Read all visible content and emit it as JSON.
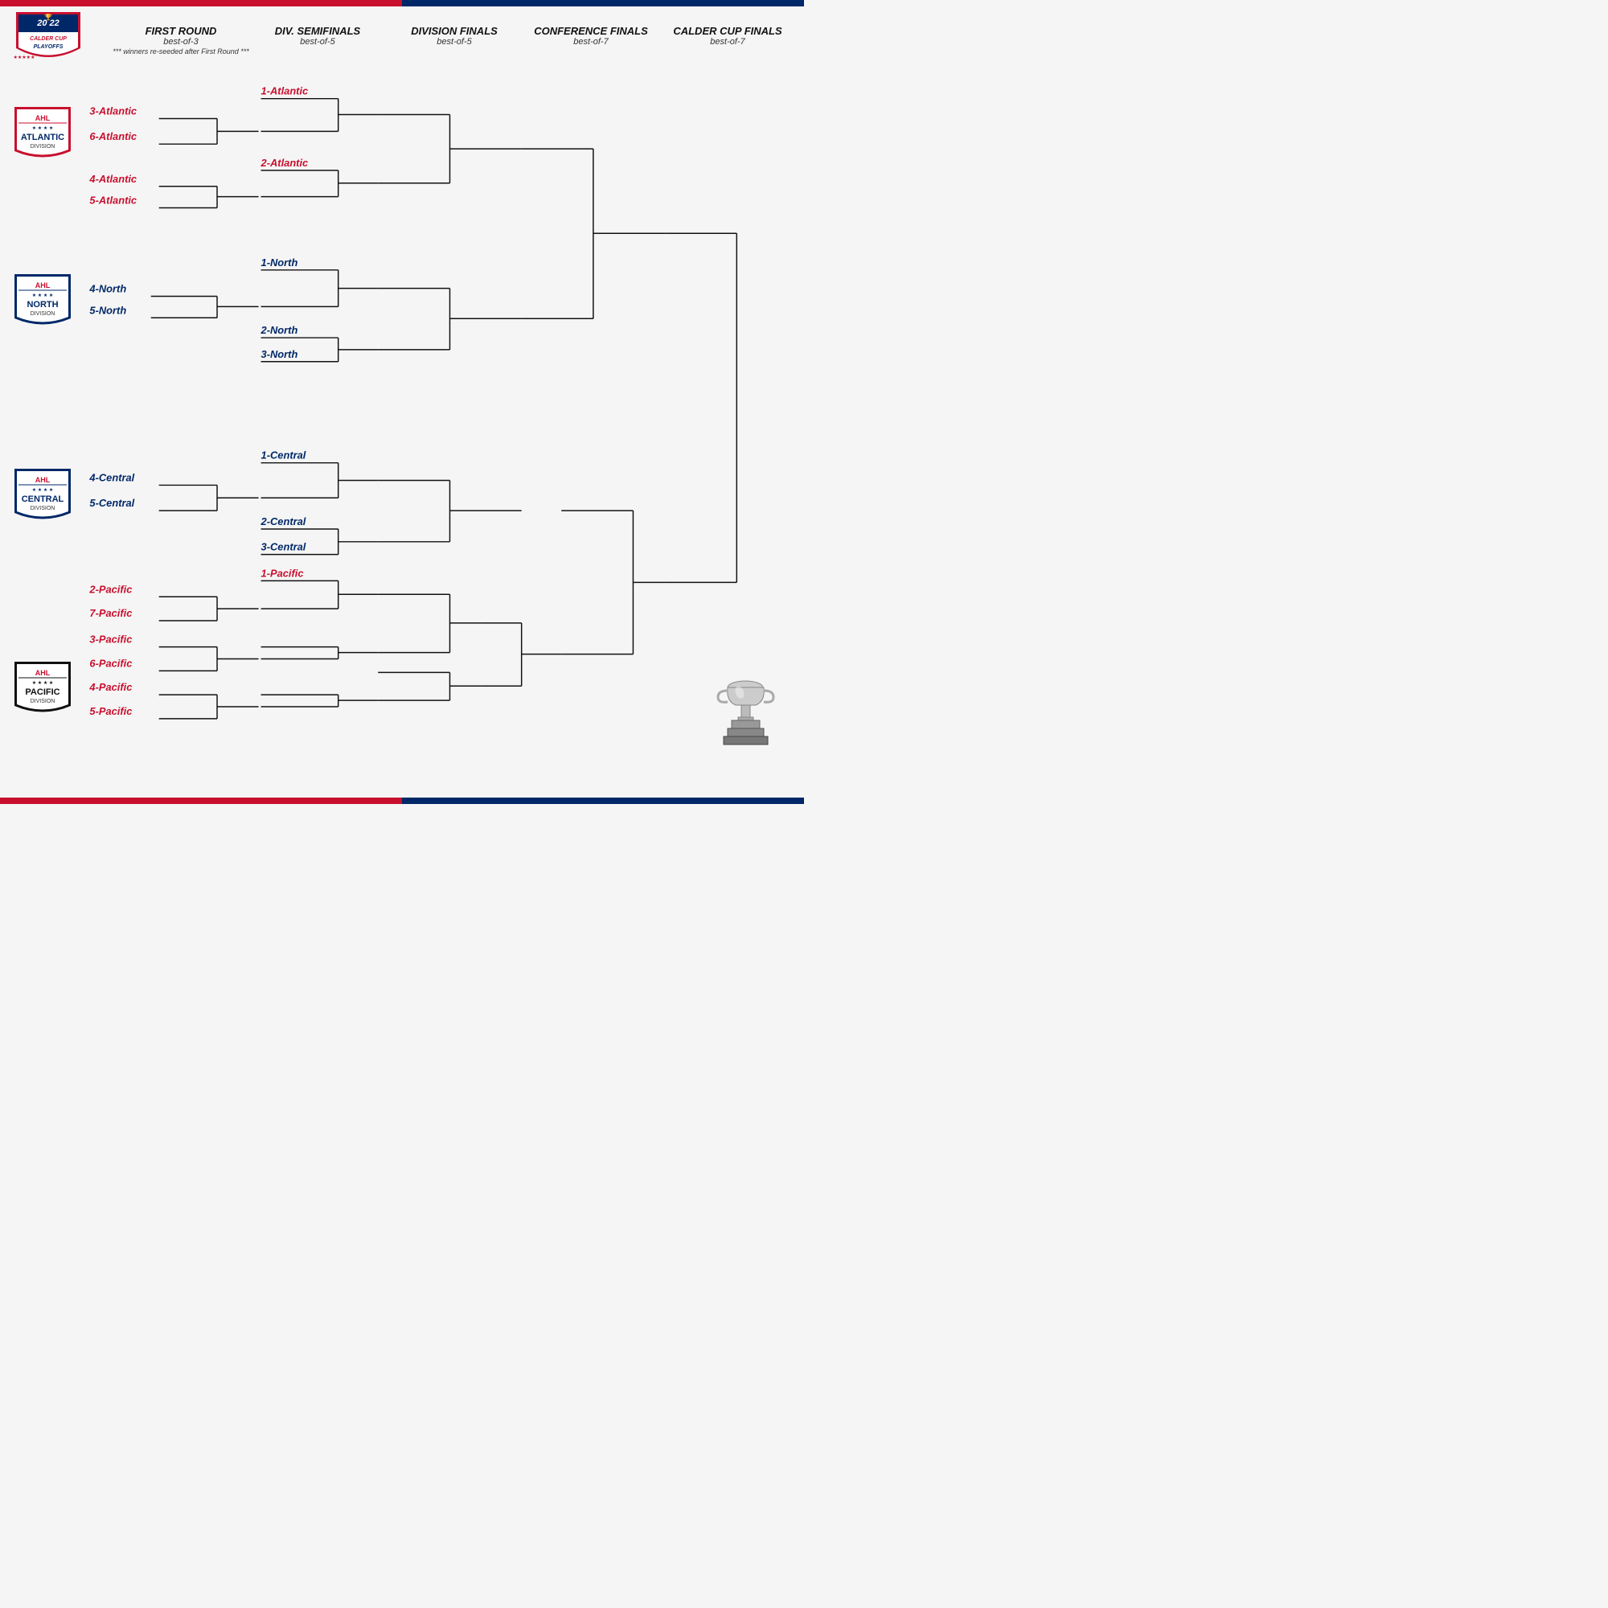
{
  "header": {
    "year": "2022",
    "title": "CALDER CUP PLAYOFFS",
    "rounds": [
      {
        "name": "FIRST ROUND",
        "format": "best-of-3",
        "note": "*** winners re-seeded after First Round ***"
      },
      {
        "name": "DIV. SEMIFINALS",
        "format": "best-of-5",
        "note": ""
      },
      {
        "name": "DIVISION FINALS",
        "format": "best-of-5",
        "note": ""
      },
      {
        "name": "CONFERENCE FINALS",
        "format": "best-of-7",
        "note": ""
      },
      {
        "name": "CALDER CUP FINALS",
        "format": "best-of-7",
        "note": ""
      }
    ]
  },
  "divisions": [
    {
      "name": "ATLANTIC",
      "color": "#c8102e",
      "text_color": "red"
    },
    {
      "name": "NORTH",
      "color": "#002868",
      "text_color": "blue"
    },
    {
      "name": "CENTRAL",
      "color": "#002868",
      "text_color": "blue"
    },
    {
      "name": "PACIFIC",
      "color": "#111111",
      "text_color": "black"
    }
  ],
  "teams": {
    "atlantic_first_round": [
      {
        "seed": "3-Atlantic",
        "color": "red"
      },
      {
        "seed": "6-Atlantic",
        "color": "red"
      },
      {
        "seed": "4-Atlantic",
        "color": "red"
      },
      {
        "seed": "5-Atlantic",
        "color": "red"
      }
    ],
    "atlantic_div_semi": [
      {
        "seed": "1-Atlantic",
        "color": "red"
      },
      {
        "seed": "2-Atlantic",
        "color": "red"
      }
    ],
    "north_first_round": [
      {
        "seed": "4-North",
        "color": "blue"
      },
      {
        "seed": "5-North",
        "color": "blue"
      }
    ],
    "north_div_semi": [
      {
        "seed": "1-North",
        "color": "blue"
      },
      {
        "seed": "2-North",
        "color": "blue"
      },
      {
        "seed": "3-North",
        "color": "blue"
      }
    ],
    "central_first_round": [
      {
        "seed": "4-Central",
        "color": "blue"
      },
      {
        "seed": "5-Central",
        "color": "blue"
      }
    ],
    "central_div_semi": [
      {
        "seed": "1-Central",
        "color": "blue"
      },
      {
        "seed": "2-Central",
        "color": "blue"
      },
      {
        "seed": "3-Central",
        "color": "blue"
      }
    ],
    "pacific_first_round": [
      {
        "seed": "2-Pacific",
        "color": "red"
      },
      {
        "seed": "7-Pacific",
        "color": "red"
      },
      {
        "seed": "3-Pacific",
        "color": "red"
      },
      {
        "seed": "6-Pacific",
        "color": "red"
      },
      {
        "seed": "4-Pacific",
        "color": "red"
      },
      {
        "seed": "5-Pacific",
        "color": "red"
      }
    ],
    "pacific_div_semi": [
      {
        "seed": "1-Pacific",
        "color": "red"
      }
    ]
  }
}
